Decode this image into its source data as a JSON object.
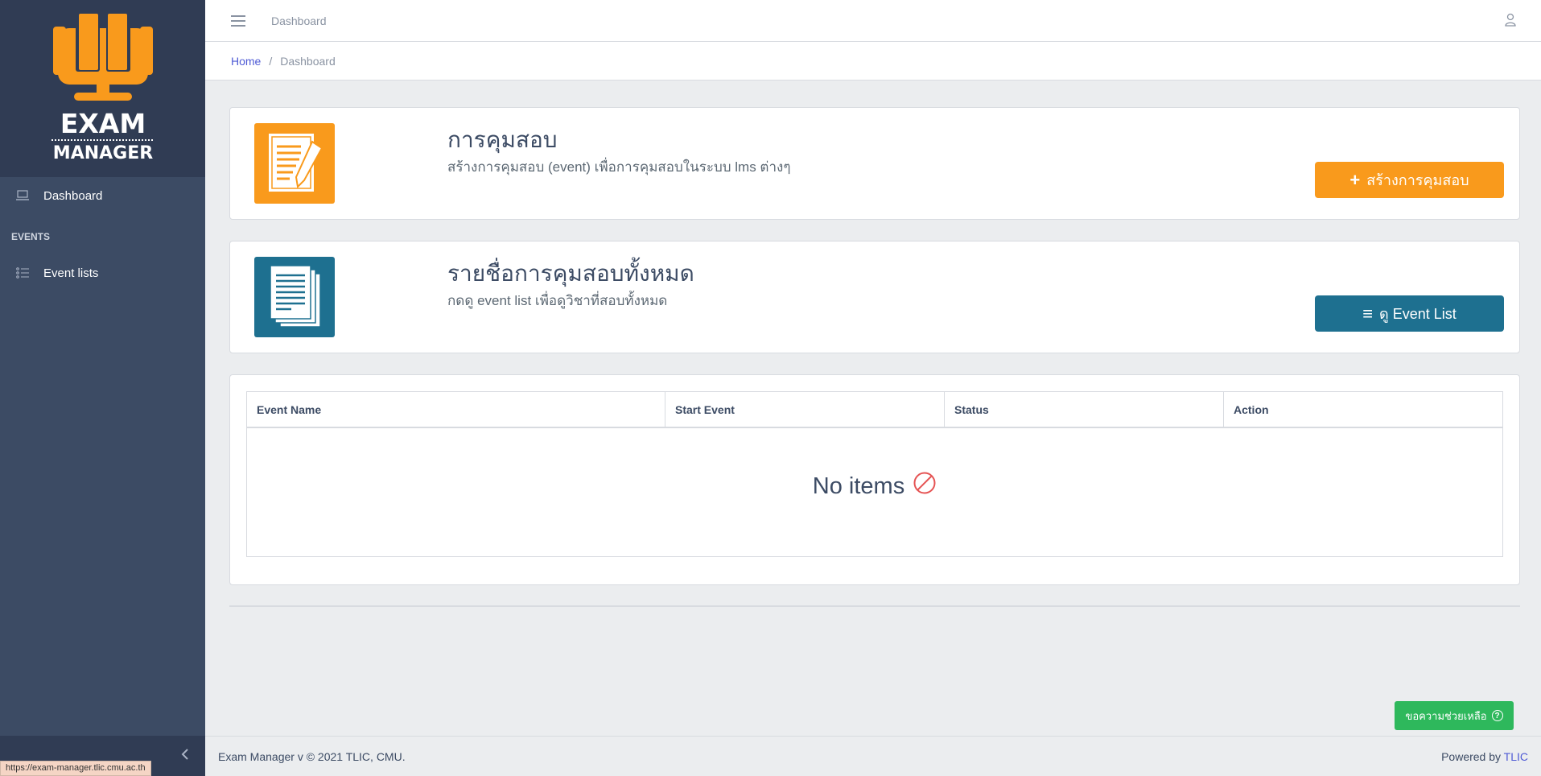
{
  "brand": {
    "logo_text_line1": "EXAM",
    "logo_text_line2": "MANAGER"
  },
  "sidebar": {
    "items": [
      {
        "label": "Dashboard",
        "icon": "laptop-icon"
      }
    ],
    "section_title": "EVENTS",
    "section_items": [
      {
        "label": "Event lists",
        "icon": "list-icon"
      }
    ]
  },
  "header": {
    "title": "Dashboard"
  },
  "breadcrumb": {
    "home": "Home",
    "sep": "/",
    "current": "Dashboard"
  },
  "cards": [
    {
      "heading": "การคุมสอบ",
      "description": "สร้างการคุมสอบ (event) เพื่อการคุมสอบในระบบ lms ต่างๆ",
      "button_icon": "+",
      "button_label": "สร้างการคุมสอบ",
      "color": "#f99a1c"
    },
    {
      "heading": "รายชื่อการคุมสอบทั้งหมด",
      "description": "กดดู event list เพื่อดูวิชาที่สอบทั้งหมด",
      "button_icon": "≡",
      "button_label": "ดู Event List",
      "color": "#1e7090"
    }
  ],
  "table": {
    "columns": [
      "Event Name",
      "Start Event",
      "Status",
      "Action"
    ],
    "empty_text": "No items"
  },
  "help_button": {
    "label": "ขอความช่วยเหลือ",
    "icon": "?"
  },
  "footer": {
    "left": "Exam Manager v  © 2021 TLIC, CMU.",
    "powered_by": "Powered by",
    "powered_link": "TLIC"
  },
  "status_url": "https://exam-manager.tlic.cmu.ac.th"
}
